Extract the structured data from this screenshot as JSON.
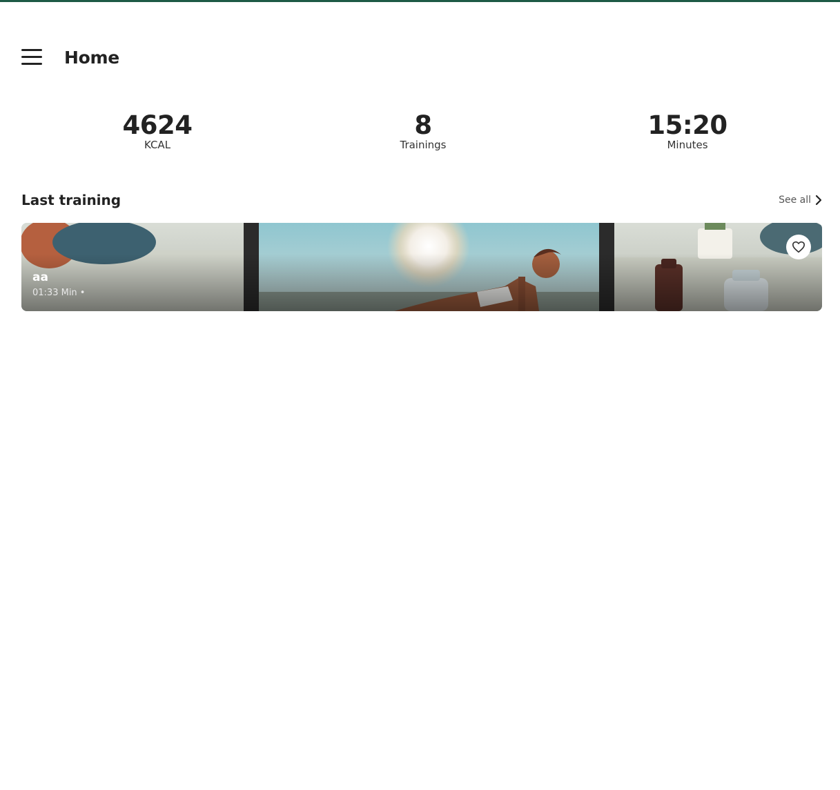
{
  "header": {
    "title": "Home",
    "menu_icon": "hamburger-menu-icon"
  },
  "stats": [
    {
      "value": "4624",
      "label": "KCAL"
    },
    {
      "value": "8",
      "label": "Trainings"
    },
    {
      "value": "15:20",
      "label": "Minutes"
    }
  ],
  "last_training": {
    "section_title": "Last training",
    "see_all_label": "See all",
    "see_all_icon": "chevron-right-icon",
    "card": {
      "name": "aa",
      "meta": "01:33 Min •",
      "favorite_icon": "heart-outline-icon"
    }
  },
  "colors": {
    "accent": "#1e5a45",
    "text": "#222222"
  }
}
